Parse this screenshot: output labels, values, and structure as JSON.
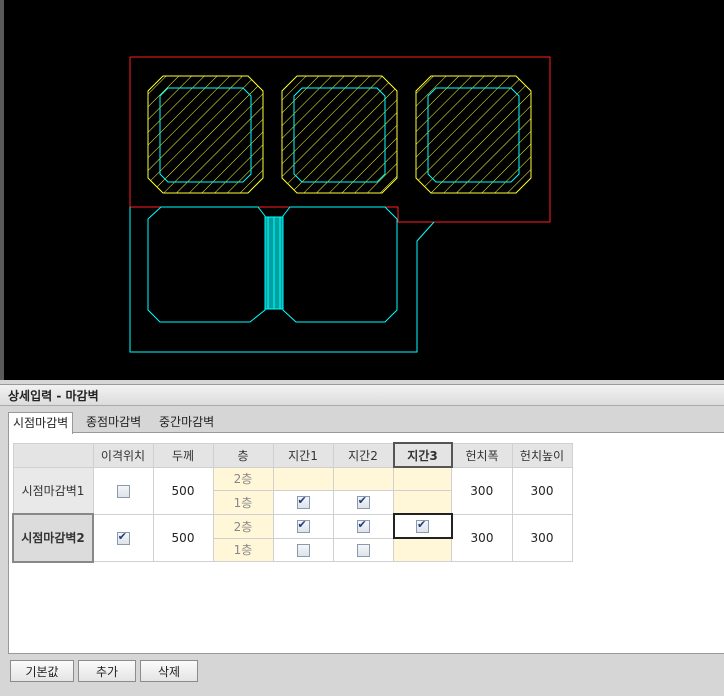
{
  "panel": {
    "title": "상세입력 - 마감벽"
  },
  "tabs": [
    "시점마감벽",
    "종점마감벽",
    "중간마감벽"
  ],
  "grid": {
    "headers": [
      "",
      "이격위치",
      "두께",
      "층",
      "지간1",
      "지간2",
      "지간3",
      "헌치폭",
      "헌치높이"
    ],
    "rows": [
      {
        "name": "시점마감벽1",
        "separation_checked": false,
        "thickness": "500",
        "floors": [
          {
            "label": "2층",
            "span1": null,
            "span2": null,
            "span3": null
          },
          {
            "label": "1층",
            "span1": true,
            "span2": true,
            "span3": null
          }
        ],
        "haunch_width": "300",
        "haunch_height": "300"
      },
      {
        "name": "시점마감벽2",
        "separation_checked": true,
        "thickness": "500",
        "floors": [
          {
            "label": "2층",
            "span1": true,
            "span2": true,
            "span3": true
          },
          {
            "label": "1층",
            "span1": false,
            "span2": false,
            "span3": null
          }
        ],
        "haunch_width": "300",
        "haunch_height": "300"
      }
    ]
  },
  "buttons": {
    "default": "기본값",
    "add": "추가",
    "delete": "삭제"
  },
  "colors": {
    "wall_red": "#ff2020",
    "hatch_yellow": "#ffff33",
    "outline_cyan": "#00ffff",
    "cad_bg": "#000000"
  }
}
